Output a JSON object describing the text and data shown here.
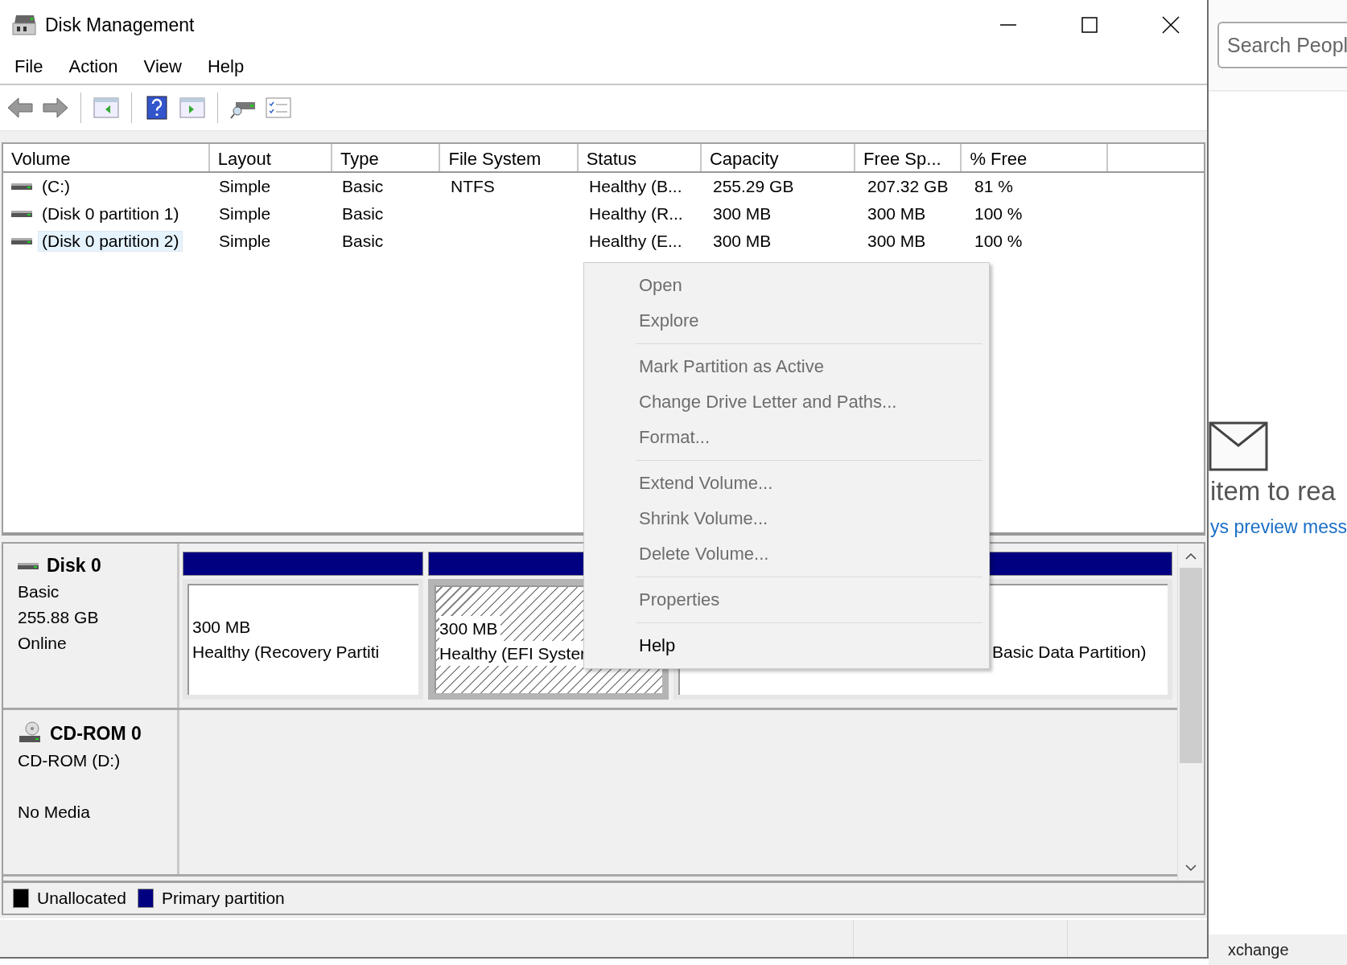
{
  "window": {
    "title": "Disk Management"
  },
  "menu": [
    "File",
    "Action",
    "View",
    "Help"
  ],
  "volumes": {
    "columns": [
      "Volume",
      "Layout",
      "Type",
      "File System",
      "Status",
      "Capacity",
      "Free Sp...",
      "% Free"
    ],
    "rows": [
      {
        "cells": [
          "(C:)",
          "Simple",
          "Basic",
          "NTFS",
          "Healthy (B...",
          "255.29 GB",
          "207.32 GB",
          "81 %"
        ],
        "selected": false
      },
      {
        "cells": [
          "(Disk 0 partition 1)",
          "Simple",
          "Basic",
          "",
          "Healthy (R...",
          "300 MB",
          "300 MB",
          "100 %"
        ],
        "selected": false
      },
      {
        "cells": [
          "(Disk 0 partition 2)",
          "Simple",
          "Basic",
          "",
          "Healthy (E...",
          "300 MB",
          "300 MB",
          "100 %"
        ],
        "selected": true
      }
    ]
  },
  "disks": [
    {
      "kind": "disk",
      "name": "Disk 0",
      "type": "Basic",
      "size": "255.88 GB",
      "state": "Online",
      "partitions": [
        {
          "size": "300 MB",
          "status": "Healthy (Recovery Partiti",
          "selected": false
        },
        {
          "size": "300 MB",
          "status": "Healthy (EFI Syster",
          "selected": true
        },
        {
          "status": "Basic Data Partition)",
          "selected": false
        }
      ]
    },
    {
      "kind": "cdrom",
      "name": "CD-ROM 0",
      "type": "CD-ROM (D:)",
      "state": "No Media"
    }
  ],
  "legend": [
    {
      "label": "Unallocated",
      "color": "#000000"
    },
    {
      "label": "Primary partition",
      "color": "#000080"
    }
  ],
  "context_menu": [
    {
      "kind": "item",
      "label": "Open",
      "disabled": true
    },
    {
      "kind": "item",
      "label": "Explore",
      "disabled": true
    },
    {
      "kind": "separator"
    },
    {
      "kind": "item",
      "label": "Mark Partition as Active",
      "disabled": true
    },
    {
      "kind": "item",
      "label": "Change Drive Letter and Paths...",
      "disabled": true
    },
    {
      "kind": "item",
      "label": "Format...",
      "disabled": true
    },
    {
      "kind": "separator"
    },
    {
      "kind": "item",
      "label": "Extend Volume...",
      "disabled": true
    },
    {
      "kind": "item",
      "label": "Shrink Volume...",
      "disabled": true
    },
    {
      "kind": "item",
      "label": "Delete Volume...",
      "disabled": true
    },
    {
      "kind": "separator"
    },
    {
      "kind": "item",
      "label": "Properties",
      "disabled": true
    },
    {
      "kind": "separator"
    },
    {
      "kind": "item",
      "label": "Help",
      "disabled": false
    }
  ],
  "outlook": {
    "search": {
      "placeholder": "Search Peopl"
    },
    "message": "item to rea",
    "link": "ys preview mess",
    "status": "xchange"
  }
}
